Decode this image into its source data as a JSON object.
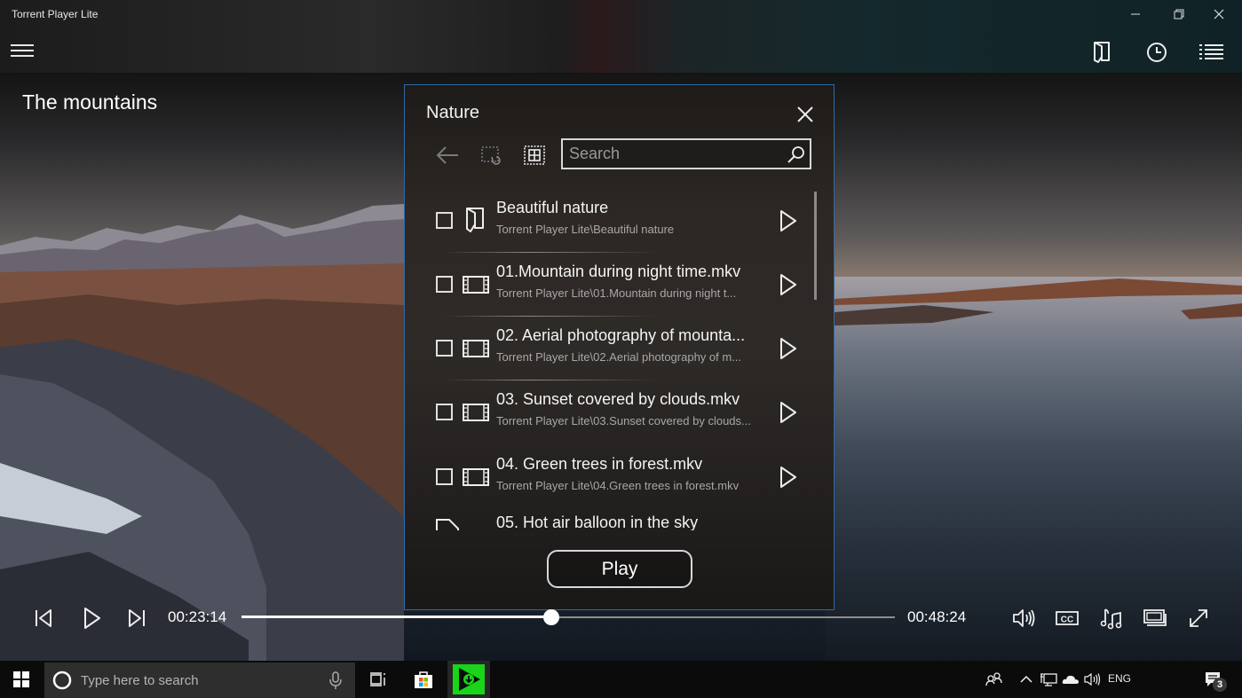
{
  "window": {
    "title": "Torrent Player Lite",
    "controls": {
      "minimize": "minimize",
      "restore": "restore",
      "close": "close"
    }
  },
  "header": {
    "menu_icon": "hamburger-icon",
    "actions": [
      {
        "name": "open-folder",
        "icon": "folder-icon"
      },
      {
        "name": "history",
        "icon": "clock-icon"
      },
      {
        "name": "playlist",
        "icon": "list-icon"
      }
    ]
  },
  "video": {
    "title": "The mountains"
  },
  "dialog": {
    "title": "Nature",
    "toolbar": {
      "back_icon": "arrow-left-icon",
      "select_undo_icon": "select-undo-icon",
      "select_all_icon": "select-all-icon"
    },
    "search": {
      "placeholder": "Search",
      "value": ""
    },
    "items": [
      {
        "type": "folder",
        "name": "Beautiful nature",
        "path": "Torrent Player Lite\\Beautiful nature",
        "checked": false
      },
      {
        "type": "video",
        "name": "01.Mountain during night time.mkv",
        "path": "Torrent Player Lite\\01.Mountain during night t...",
        "checked": false
      },
      {
        "type": "video",
        "name": "02. Aerial photography of mounta...",
        "path": "Torrent Player Lite\\02.Aerial photography of m...",
        "checked": false
      },
      {
        "type": "video",
        "name": "03. Sunset covered by clouds.mkv",
        "path": "Torrent Player Lite\\03.Sunset covered by clouds...",
        "checked": false
      },
      {
        "type": "video",
        "name": "04. Green trees in forest.mkv",
        "path": "Torrent Player Lite\\04.Green trees in forest.mkv",
        "checked": false
      },
      {
        "type": "file",
        "name": "05. Hot air balloon in the sky",
        "path": "",
        "checked": false
      }
    ],
    "play_label": "Play",
    "accent_border": "#2f6aa8"
  },
  "player": {
    "current_time": "00:23:14",
    "total_time": "00:48:24",
    "progress_percent": 47.4,
    "controls": [
      "previous",
      "play",
      "next"
    ],
    "right_controls": [
      "volume",
      "subtitles",
      "audio-track",
      "picture-in-picture",
      "fullscreen"
    ]
  },
  "taskbar": {
    "search_placeholder": "Type here to search",
    "language": "ENG",
    "notification_count": "3",
    "active_app_color": "#19d419"
  }
}
